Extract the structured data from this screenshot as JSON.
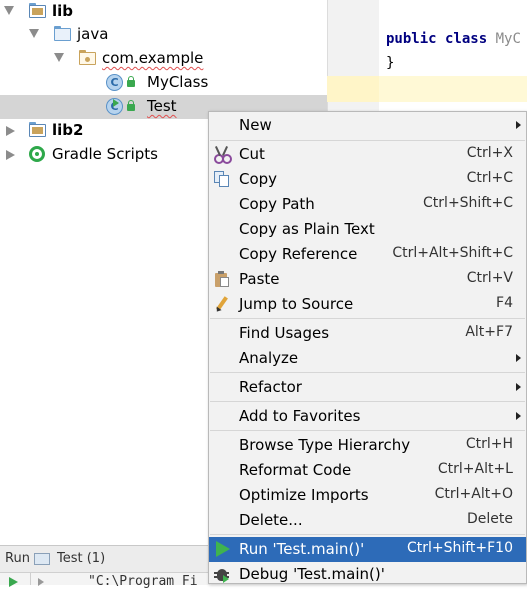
{
  "tree": {
    "items": [
      {
        "label": "lib",
        "bold": true
      },
      {
        "label": "java"
      },
      {
        "label": "com.example"
      },
      {
        "label": "MyClass"
      },
      {
        "label": "Test"
      },
      {
        "label": "lib2",
        "bold": true
      },
      {
        "label": "Gradle Scripts"
      }
    ]
  },
  "editor": {
    "line1_keywords": "public class",
    "line1_name": "MyC",
    "line2": "}"
  },
  "runbar": {
    "run_label": "Run",
    "tab_label": "Test (1)",
    "console_text": "\"C:\\Program Fi"
  },
  "menu": {
    "items": [
      {
        "label": "New",
        "shortcut": "",
        "submenu": true
      },
      {
        "label": "Cut",
        "shortcut": "Ctrl+X",
        "icon": "scissors-icon"
      },
      {
        "label": "Copy",
        "shortcut": "Ctrl+C",
        "icon": "copy-icon"
      },
      {
        "label": "Copy Path",
        "shortcut": "Ctrl+Shift+C"
      },
      {
        "label": "Copy as Plain Text",
        "shortcut": ""
      },
      {
        "label": "Copy Reference",
        "shortcut": "Ctrl+Alt+Shift+C"
      },
      {
        "label": "Paste",
        "shortcut": "Ctrl+V",
        "icon": "paste-icon"
      },
      {
        "label": "Jump to Source",
        "shortcut": "F4",
        "icon": "jump-to-source-icon"
      },
      {
        "label": "Find Usages",
        "shortcut": "Alt+F7"
      },
      {
        "label": "Analyze",
        "shortcut": "",
        "submenu": true
      },
      {
        "label": "Refactor",
        "shortcut": "",
        "submenu": true
      },
      {
        "label": "Add to Favorites",
        "shortcut": "",
        "submenu": true
      },
      {
        "label": "Browse Type Hierarchy",
        "shortcut": "Ctrl+H"
      },
      {
        "label": "Reformat Code",
        "shortcut": "Ctrl+Alt+L"
      },
      {
        "label": "Optimize Imports",
        "shortcut": "Ctrl+Alt+O"
      },
      {
        "label": "Delete...",
        "shortcut": "Delete"
      },
      {
        "label": "Run 'Test.main()'",
        "shortcut": "Ctrl+Shift+F10",
        "icon": "run-icon",
        "active": true
      },
      {
        "label": "Debug 'Test.main()'",
        "shortcut": "",
        "icon": "debug-icon"
      }
    ]
  },
  "colors": {
    "menu_highlight": "#2d6bb8",
    "tree_selection": "#d5d5d5",
    "keyword": "#000080",
    "run_green": "#3fb34f"
  }
}
